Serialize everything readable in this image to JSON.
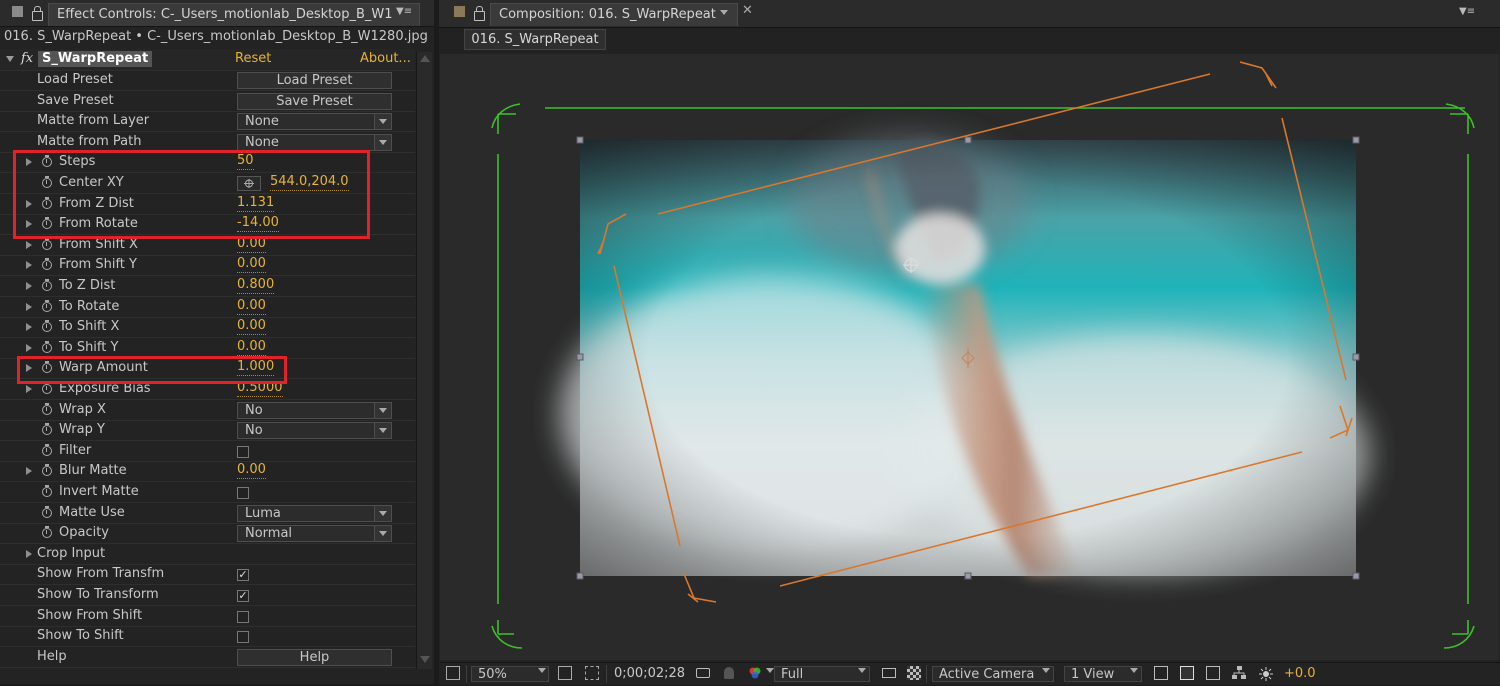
{
  "effect_controls": {
    "tab_title": "Effect Controls: C-_Users_motionlab_Desktop_B_W1",
    "source": "016. S_WarpRepeat • C-_Users_motionlab_Desktop_B_W1280.jpg",
    "effect": {
      "name": "S_WarpRepeat",
      "fx": "fx",
      "reset": "Reset",
      "about": "About..."
    },
    "rows": [
      {
        "label": "Load Preset",
        "button": "Load Preset"
      },
      {
        "label": "Save Preset",
        "button": "Save Preset"
      },
      {
        "label": "Matte from Layer",
        "dropdown": "None"
      },
      {
        "label": "Matte from Path",
        "dropdown": "None"
      },
      {
        "label": "Steps",
        "value": "50"
      },
      {
        "label": "Center XY",
        "value": "544.0,204.0"
      },
      {
        "label": "From Z Dist",
        "value": "1.131"
      },
      {
        "label": "From Rotate",
        "value": "-14.00"
      },
      {
        "label": "From Shift X",
        "value": "0.00"
      },
      {
        "label": "From Shift Y",
        "value": "0.00"
      },
      {
        "label": "To Z Dist",
        "value": "0.800"
      },
      {
        "label": "To Rotate",
        "value": "0.00"
      },
      {
        "label": "To Shift X",
        "value": "0.00"
      },
      {
        "label": "To Shift Y",
        "value": "0.00"
      },
      {
        "label": "Warp Amount",
        "value": "1.000"
      },
      {
        "label": "Exposure Bias",
        "value": "0.5000"
      },
      {
        "label": "Wrap X",
        "dropdown": "No"
      },
      {
        "label": "Wrap Y",
        "dropdown": "No"
      },
      {
        "label": "Filter",
        "checked": false
      },
      {
        "label": "Blur Matte",
        "value": "0.00"
      },
      {
        "label": "Invert Matte",
        "checked": false
      },
      {
        "label": "Matte Use",
        "dropdown": "Luma"
      },
      {
        "label": "Opacity",
        "dropdown": "Normal"
      },
      {
        "label": "Crop Input"
      },
      {
        "label": "Show From Transfm",
        "checked": true
      },
      {
        "label": "Show To Transform",
        "checked": true
      },
      {
        "label": "Show From Shift",
        "checked": false
      },
      {
        "label": "Show To Shift",
        "checked": false
      },
      {
        "label": "Help",
        "button": "Help"
      }
    ],
    "checkmark": "✓"
  },
  "composition": {
    "tab_title": "Composition: 016. S_WarpRepeat",
    "comp_tab": "016. S_WarpRepeat",
    "footer": {
      "zoom": "50%",
      "timecode": "0;00;02;28",
      "resolution": "Full",
      "camera": "Active Camera",
      "view": "1 View",
      "exposure": "+0.0"
    }
  },
  "colors": {
    "value": "#e6b23a",
    "highlight": "#e0232a",
    "guide_green": "#3fbf2a",
    "warp_orange": "#d9772d"
  }
}
